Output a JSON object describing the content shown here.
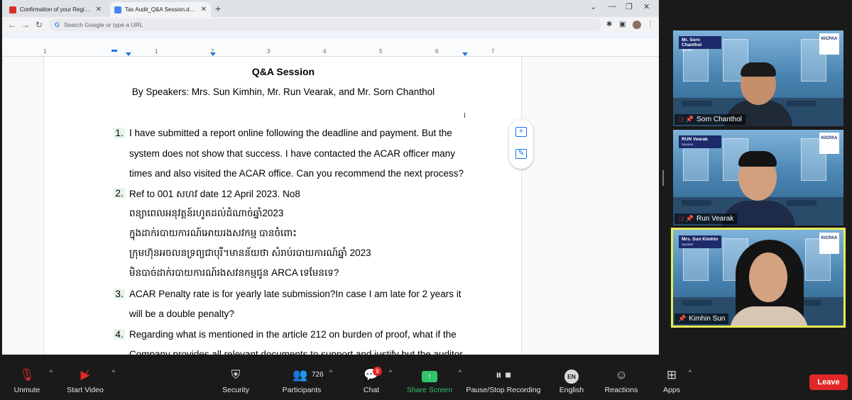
{
  "browser": {
    "tabs": [
      {
        "title": "Confirmation of your Registration",
        "favicon": "gmail-icon",
        "color": "#d93025"
      },
      {
        "title": "Tax Audit_Q&A Session.docx - Go",
        "favicon": "docs-icon",
        "color": "#4285f4"
      }
    ],
    "address_placeholder": "Search Google or type a URL"
  },
  "document": {
    "title": "Q&A Session",
    "subtitle": "By Speakers: Mrs. Sun Kimhin, Mr. Run Vearak, and Mr. Sorn Chanthol",
    "ruler_numbers": [
      "1",
      "1",
      "2",
      "3",
      "4",
      "5",
      "6",
      "7"
    ],
    "questions": [
      {
        "num": "1.",
        "lines": [
          "I have submitted a report online following the deadline and payment. But the",
          "system does not show that success. I have contacted the ACAR officer many",
          "times and also visited the ACAR office. Can you recommend the next process?"
        ]
      },
      {
        "num": "2.",
        "lines": [
          "Ref to 001 សហវ date 12 April 2023. No8",
          "ពន្យាពេលអនុវត្តន៍រហូតដល់ដំណាច់ឆ្នាំ2023",
          "ក្នុងដាក់របាយការណ៍អោយរងសវកម្ម បានចំពោះ",
          "ក្រុមហ៊ុនអចលនទ្រព្យជាបុរី។មានន័យថា សំរាប់របាយការណ៍ឆ្នាំ 2023",
          "មិនបាច់ដាក់របាយការណ៍រងសវនកម្មជូន ARCA ទេមែនទេ?"
        ]
      },
      {
        "num": "3.",
        "lines": [
          "ACAR Penalty rate is for yearly late submission?In case I am late for 2 years it",
          "will be a double penalty?"
        ]
      },
      {
        "num": "4.",
        "lines": [
          "Regarding what is mentioned in the article 212 on burden of proof,  what if the",
          "Company provides all relevant documents to support and justify but the auditor"
        ]
      }
    ]
  },
  "participants": [
    {
      "name": "Sorn Chanthol",
      "badge": "Mr. Sorn Chanthol",
      "badge_sub": "Speaker",
      "muted": true,
      "logo": "KICPAA"
    },
    {
      "name": "Run Vearak",
      "badge": "RUN Vearak",
      "badge_sub": "Speaker",
      "muted": true,
      "logo": "KICPAA"
    },
    {
      "name": "Kimhin Sun",
      "badge": "Mrs. Sun Kimhin",
      "badge_sub": "Speaker",
      "muted": false,
      "logo": "KICPAA"
    }
  ],
  "controls": {
    "unmute": "Unmute",
    "start_video": "Start Video",
    "security": "Security",
    "participants": "Participants",
    "participant_count": "726",
    "chat": "Chat",
    "chat_badge": "9",
    "share_screen": "Share Screen",
    "recording": "Pause/Stop Recording",
    "language_code": "EN",
    "language": "English",
    "reactions": "Reactions",
    "apps": "Apps",
    "leave": "Leave"
  },
  "colors": {
    "share_green": "#31c46a",
    "leave_red": "#e02828",
    "active_speaker": "#e8eb57"
  }
}
